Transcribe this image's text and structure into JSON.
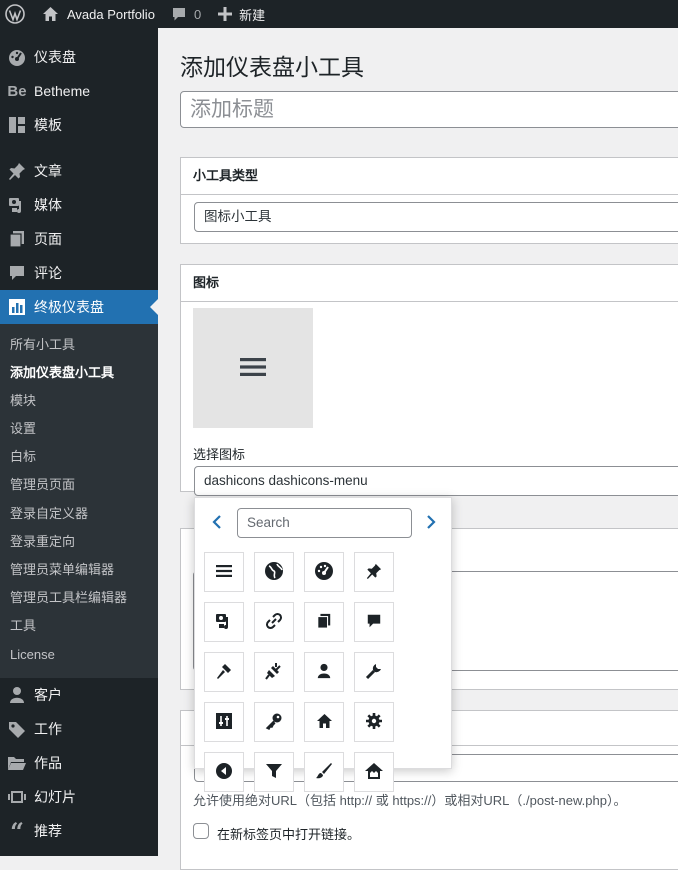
{
  "adminbar": {
    "site_name": "Avada Portfolio",
    "comments_count": "0",
    "new_label": "新建"
  },
  "sidebar": {
    "top_items": [
      {
        "label": "仪表盘",
        "icon": "dashboard-icon"
      },
      {
        "label": "Betheme",
        "icon": "betheme-icon"
      },
      {
        "label": "模板",
        "icon": "template-icon"
      }
    ],
    "main_items": [
      {
        "label": "文章",
        "icon": "pin-icon"
      },
      {
        "label": "媒体",
        "icon": "media-icon"
      },
      {
        "label": "页面",
        "icon": "pages-icon"
      },
      {
        "label": "评论",
        "icon": "comment-icon"
      },
      {
        "label": "终极仪表盘",
        "icon": "chart-icon"
      }
    ],
    "submenu": [
      "所有小工具",
      "添加仪表盘小工具",
      "模块",
      "设置",
      "白标",
      "管理员页面",
      "登录自定义器",
      "登录重定向",
      "管理员菜单编辑器",
      "管理员工具栏编辑器",
      "工具",
      "License"
    ],
    "bottom_items": [
      {
        "label": "客户",
        "icon": "person-icon"
      },
      {
        "label": "工作",
        "icon": "tag-icon"
      },
      {
        "label": "作品",
        "icon": "folder-icon"
      },
      {
        "label": "幻灯片",
        "icon": "slides-icon"
      },
      {
        "label": "推荐",
        "icon": "quote-icon"
      }
    ]
  },
  "main": {
    "page_title": "添加仪表盘小工具",
    "title_placeholder": "添加标题",
    "widget_type": {
      "heading": "小工具类型",
      "value": "图标小工具"
    },
    "icon_box": {
      "heading": "图标",
      "select_label": "选择图标",
      "select_value": "dashicons dashicons-menu"
    },
    "link_help": "允许使用绝对URL（包括 http:// 或 https://）或相对URL（./post-new.php）。",
    "new_tab_label": "在新标签页中打开链接。"
  },
  "picker": {
    "search_placeholder": "Search",
    "icons": [
      "menu-icon",
      "globe-icon",
      "dashboard-icon",
      "pin-icon",
      "media-icon",
      "link-icon",
      "pages-icon",
      "comment-icon",
      "appearance-icon",
      "plugins-icon",
      "users-icon",
      "tools-icon",
      "settings-icon",
      "key-icon",
      "home-icon",
      "gear-icon",
      "back-icon",
      "filter-icon",
      "brush-icon",
      "network-icon"
    ]
  },
  "colors": {
    "adminbar": "#1d2327",
    "sidebar": "#1d2327",
    "submenu": "#2c3338",
    "accent": "#2271b1"
  }
}
